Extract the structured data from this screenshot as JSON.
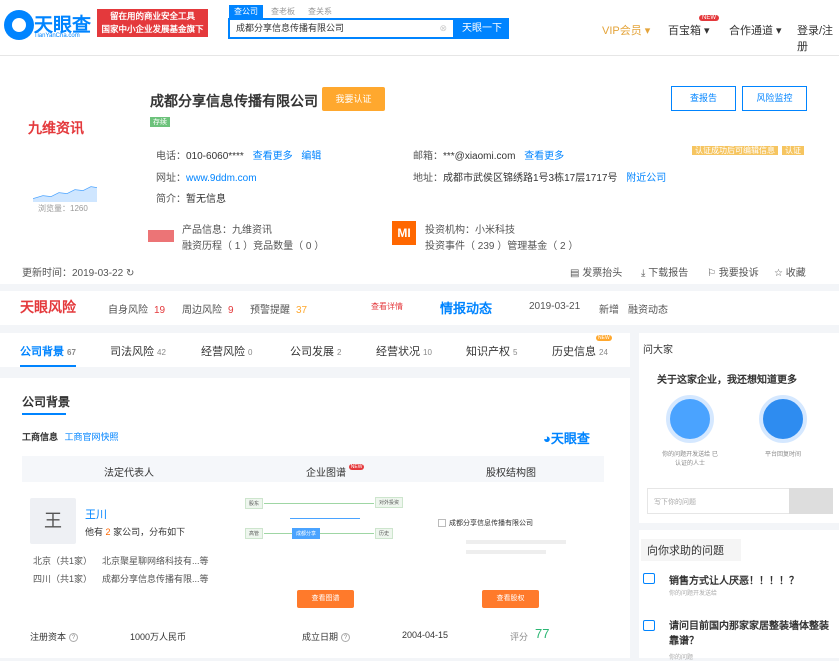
{
  "header": {
    "logo_text": "天眼查",
    "logo_sub": "TianYanCha.com",
    "banner_line1": "留在用的商业安全工具",
    "banner_line2": "国家中小企业发展基金旗下",
    "search_tabs": [
      "查公司",
      "查老板",
      "查关系"
    ],
    "search_value": "成都分享信息传播有限公司",
    "search_button": "天眼一下",
    "nav": {
      "vip": "VIP会员 ▾",
      "apps": "百宝箱 ▾",
      "apps_badge": "NEW",
      "partner": "合作通道 ▾",
      "login": "登录/注册"
    }
  },
  "company": {
    "logo_text": "九维资讯",
    "views_label": "浏览量：1260",
    "name": "成都分享信息传播有限公司",
    "claim_button": "我要认证",
    "status_tag": "存续",
    "buttons": {
      "report": "查报告",
      "risk": "风险监控"
    },
    "phone_label": "电话：",
    "phone": "010-6060****",
    "phone_more": "查看更多",
    "phone_edit": "编辑",
    "email_label": "邮箱：",
    "email": "***@xiaomi.com",
    "email_more": "查看更多",
    "site_label": "网址：",
    "site": "www.9ddm.com",
    "address_label": "地址：",
    "address": "成都市武侯区锦绣路1号3栋17层1717号",
    "address_link": "附近公司",
    "intro_label": "简介：",
    "intro": "暂无信息",
    "verify_hint": "认证成功后可编辑信息",
    "verify_badge": "认证",
    "product_line1": "产品信息：九维资讯",
    "product_line2": "融资历程（ 1 ）竞品数量（ 0 ）",
    "investor_logo": "MI",
    "investor_line1": "投资机构：小米科技",
    "investor_line2": "投资事件（ 239 ）管理基金（ 2 ）",
    "updated": "更新时间：2019-03-22",
    "actions": [
      "发票抬头",
      "下载报告",
      "我要投诉",
      "收藏"
    ]
  },
  "risk": {
    "logo": "天眼风险",
    "items": [
      {
        "label": "自身风险",
        "value": "19"
      },
      {
        "label": "周边风险",
        "value": "9"
      },
      {
        "label": "预警提醒",
        "value": "37"
      }
    ],
    "more": "查看详情",
    "intel_logo": "情报动态",
    "date": "2019-03-21",
    "new_label": "新增",
    "event": "融资动态"
  },
  "tabs": [
    {
      "label": "公司背景",
      "count": "67"
    },
    {
      "label": "司法风险",
      "count": "42"
    },
    {
      "label": "经营风险",
      "count": "0"
    },
    {
      "label": "公司发展",
      "count": "2"
    },
    {
      "label": "经营状况",
      "count": "10"
    },
    {
      "label": "知识产权",
      "count": "5"
    },
    {
      "label": "历史信息",
      "count": "24",
      "badge": "NEW"
    }
  ],
  "main": {
    "section_title": "公司背景",
    "biz_info": "工商信息",
    "biz_link": "工商官网快照",
    "brand": "天眼查",
    "col_rep": "法定代表人",
    "col_graph": "企业图谱",
    "col_graph_badge": "NEW",
    "col_equity": "股权结构图",
    "avatar_char": "王",
    "rep_name": "王川",
    "rep_desc_prefix": "他有",
    "rep_desc_count": "2",
    "rep_desc_suffix": "家公司，分布如下",
    "rep_companies": [
      {
        "region": "北京（共1家）",
        "name": "北京聚星聊网络科技有...等"
      },
      {
        "region": "四川（共1家）",
        "name": "成都分享信息传播有限...等"
      }
    ],
    "graph_nodes": [
      "股东",
      "高管",
      "成都分享",
      "对外投资",
      "历史"
    ],
    "equity_company": "成都分享信息传播有限公司",
    "btn_graph": "查看图谱",
    "btn_equity": "查看股权",
    "reg_capital_label": "注册资本",
    "reg_capital": "1000万人民币",
    "est_date_label": "成立日期",
    "est_date": "2004-04-15",
    "score_label": "评分",
    "score": "77"
  },
  "sidebar": {
    "ask_title": "问大家",
    "ask_heading": "关于这家企业，我还想知道更多",
    "ask_item1": "你的问题开发送给\n已认证的人士",
    "ask_item2": "平台回复时间",
    "ask_placeholder": "写下你的问题",
    "q_title": "向你求助的问题",
    "questions": [
      {
        "title": "销售方式让人厌恶！！！！？",
        "sub": "你的问题开发送给"
      },
      {
        "title": "请问目前国内那家家居整装墙体整装靠谱？",
        "sub": "你的问题"
      }
    ]
  },
  "colors": {
    "accent": "#0084ff",
    "danger": "#e4393c",
    "orange": "#ffa82e"
  }
}
